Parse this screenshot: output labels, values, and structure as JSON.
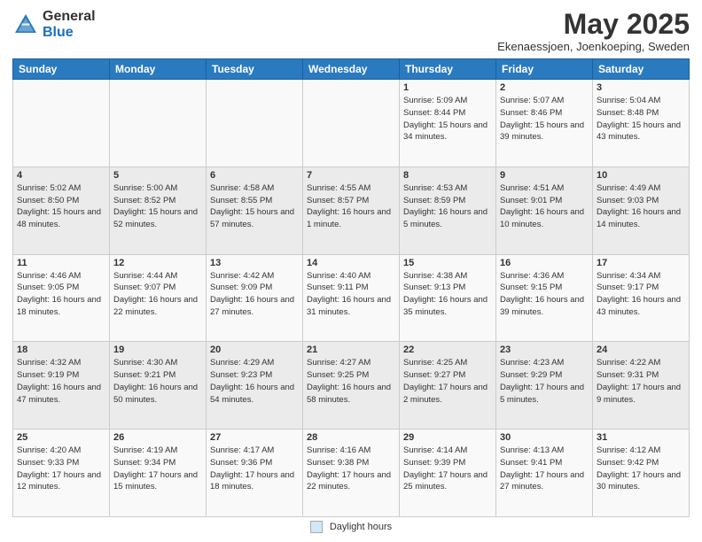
{
  "header": {
    "logo_general": "General",
    "logo_blue": "Blue",
    "month": "May 2025",
    "location": "Ekenaessjoen, Joenkoeping, Sweden"
  },
  "weekdays": [
    "Sunday",
    "Monday",
    "Tuesday",
    "Wednesday",
    "Thursday",
    "Friday",
    "Saturday"
  ],
  "footer": {
    "legend_label": "Daylight hours"
  },
  "weeks": [
    [
      {
        "day": "",
        "info": ""
      },
      {
        "day": "",
        "info": ""
      },
      {
        "day": "",
        "info": ""
      },
      {
        "day": "",
        "info": ""
      },
      {
        "day": "1",
        "info": "Sunrise: 5:09 AM\nSunset: 8:44 PM\nDaylight: 15 hours\nand 34 minutes."
      },
      {
        "day": "2",
        "info": "Sunrise: 5:07 AM\nSunset: 8:46 PM\nDaylight: 15 hours\nand 39 minutes."
      },
      {
        "day": "3",
        "info": "Sunrise: 5:04 AM\nSunset: 8:48 PM\nDaylight: 15 hours\nand 43 minutes."
      }
    ],
    [
      {
        "day": "4",
        "info": "Sunrise: 5:02 AM\nSunset: 8:50 PM\nDaylight: 15 hours\nand 48 minutes."
      },
      {
        "day": "5",
        "info": "Sunrise: 5:00 AM\nSunset: 8:52 PM\nDaylight: 15 hours\nand 52 minutes."
      },
      {
        "day": "6",
        "info": "Sunrise: 4:58 AM\nSunset: 8:55 PM\nDaylight: 15 hours\nand 57 minutes."
      },
      {
        "day": "7",
        "info": "Sunrise: 4:55 AM\nSunset: 8:57 PM\nDaylight: 16 hours\nand 1 minute."
      },
      {
        "day": "8",
        "info": "Sunrise: 4:53 AM\nSunset: 8:59 PM\nDaylight: 16 hours\nand 5 minutes."
      },
      {
        "day": "9",
        "info": "Sunrise: 4:51 AM\nSunset: 9:01 PM\nDaylight: 16 hours\nand 10 minutes."
      },
      {
        "day": "10",
        "info": "Sunrise: 4:49 AM\nSunset: 9:03 PM\nDaylight: 16 hours\nand 14 minutes."
      }
    ],
    [
      {
        "day": "11",
        "info": "Sunrise: 4:46 AM\nSunset: 9:05 PM\nDaylight: 16 hours\nand 18 minutes."
      },
      {
        "day": "12",
        "info": "Sunrise: 4:44 AM\nSunset: 9:07 PM\nDaylight: 16 hours\nand 22 minutes."
      },
      {
        "day": "13",
        "info": "Sunrise: 4:42 AM\nSunset: 9:09 PM\nDaylight: 16 hours\nand 27 minutes."
      },
      {
        "day": "14",
        "info": "Sunrise: 4:40 AM\nSunset: 9:11 PM\nDaylight: 16 hours\nand 31 minutes."
      },
      {
        "day": "15",
        "info": "Sunrise: 4:38 AM\nSunset: 9:13 PM\nDaylight: 16 hours\nand 35 minutes."
      },
      {
        "day": "16",
        "info": "Sunrise: 4:36 AM\nSunset: 9:15 PM\nDaylight: 16 hours\nand 39 minutes."
      },
      {
        "day": "17",
        "info": "Sunrise: 4:34 AM\nSunset: 9:17 PM\nDaylight: 16 hours\nand 43 minutes."
      }
    ],
    [
      {
        "day": "18",
        "info": "Sunrise: 4:32 AM\nSunset: 9:19 PM\nDaylight: 16 hours\nand 47 minutes."
      },
      {
        "day": "19",
        "info": "Sunrise: 4:30 AM\nSunset: 9:21 PM\nDaylight: 16 hours\nand 50 minutes."
      },
      {
        "day": "20",
        "info": "Sunrise: 4:29 AM\nSunset: 9:23 PM\nDaylight: 16 hours\nand 54 minutes."
      },
      {
        "day": "21",
        "info": "Sunrise: 4:27 AM\nSunset: 9:25 PM\nDaylight: 16 hours\nand 58 minutes."
      },
      {
        "day": "22",
        "info": "Sunrise: 4:25 AM\nSunset: 9:27 PM\nDaylight: 17 hours\nand 2 minutes."
      },
      {
        "day": "23",
        "info": "Sunrise: 4:23 AM\nSunset: 9:29 PM\nDaylight: 17 hours\nand 5 minutes."
      },
      {
        "day": "24",
        "info": "Sunrise: 4:22 AM\nSunset: 9:31 PM\nDaylight: 17 hours\nand 9 minutes."
      }
    ],
    [
      {
        "day": "25",
        "info": "Sunrise: 4:20 AM\nSunset: 9:33 PM\nDaylight: 17 hours\nand 12 minutes."
      },
      {
        "day": "26",
        "info": "Sunrise: 4:19 AM\nSunset: 9:34 PM\nDaylight: 17 hours\nand 15 minutes."
      },
      {
        "day": "27",
        "info": "Sunrise: 4:17 AM\nSunset: 9:36 PM\nDaylight: 17 hours\nand 18 minutes."
      },
      {
        "day": "28",
        "info": "Sunrise: 4:16 AM\nSunset: 9:38 PM\nDaylight: 17 hours\nand 22 minutes."
      },
      {
        "day": "29",
        "info": "Sunrise: 4:14 AM\nSunset: 9:39 PM\nDaylight: 17 hours\nand 25 minutes."
      },
      {
        "day": "30",
        "info": "Sunrise: 4:13 AM\nSunset: 9:41 PM\nDaylight: 17 hours\nand 27 minutes."
      },
      {
        "day": "31",
        "info": "Sunrise: 4:12 AM\nSunset: 9:42 PM\nDaylight: 17 hours\nand 30 minutes."
      }
    ]
  ]
}
